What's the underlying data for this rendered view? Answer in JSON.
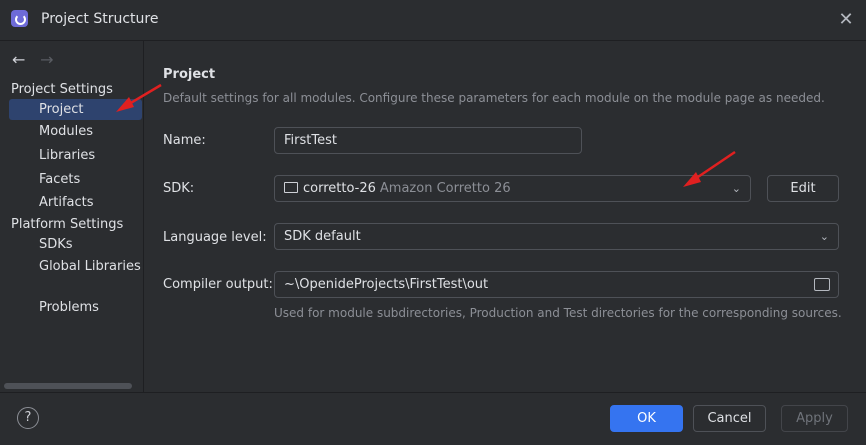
{
  "window": {
    "title": "Project Structure"
  },
  "sidebar": {
    "groups": [
      {
        "label": "Project Settings",
        "items": [
          "Project",
          "Modules",
          "Libraries",
          "Facets",
          "Artifacts"
        ]
      },
      {
        "label": "Platform Settings",
        "items": [
          "SDKs",
          "Global Libraries"
        ]
      }
    ],
    "problems": "Problems",
    "selected": "Project"
  },
  "main": {
    "heading": "Project",
    "description": "Default settings for all modules. Configure these parameters for each module on the module page as needed.",
    "name_label": "Name:",
    "name_value": "FirstTest",
    "sdk_label": "SDK:",
    "sdk_name": "corretto-26",
    "sdk_desc": "Amazon Corretto 26",
    "edit_button": "Edit",
    "language_label": "Language level:",
    "language_value": "SDK default",
    "compiler_label": "Compiler output:",
    "compiler_value": "~\\OpenideProjects\\FirstTest\\out",
    "compiler_hint": "Used for module subdirectories, Production and Test directories for the corresponding sources."
  },
  "footer": {
    "ok": "OK",
    "cancel": "Cancel",
    "apply": "Apply",
    "help": "?"
  },
  "colors": {
    "accent": "#3574f0",
    "selection": "#2e436e",
    "annotation": "#e02020"
  }
}
